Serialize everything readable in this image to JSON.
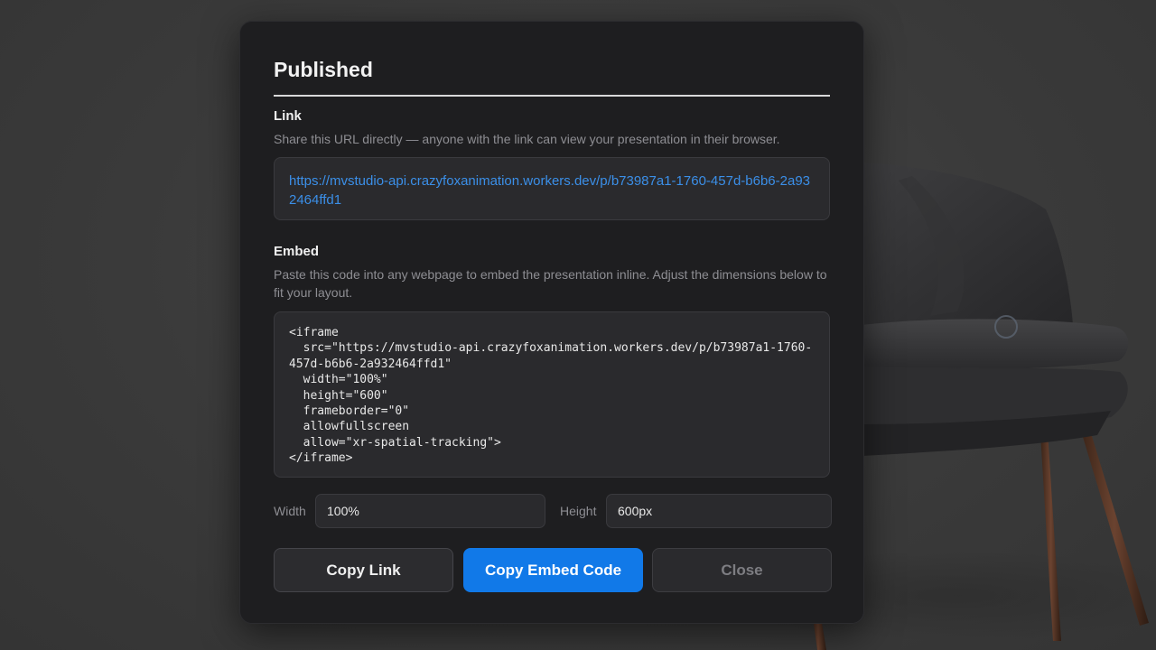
{
  "colors": {
    "accent": "#1179e8",
    "link": "#3b8fe8",
    "modal_bg": "#1e1e20"
  },
  "dialog": {
    "title": "Published",
    "link_section": {
      "label": "Link",
      "description": "Share this URL directly — anyone with the link can view your presentation in their browser.",
      "url": "https://mvstudio-api.crazyfoxanimation.workers.dev/p/b73987a1-1760-457d-b6b6-2a932464ffd1"
    },
    "embed_section": {
      "label": "Embed",
      "description": "Paste this code into any webpage to embed the presentation inline. Adjust the dimensions below to fit your layout.",
      "code": "<iframe\n  src=\"https://mvstudio-api.crazyfoxanimation.workers.dev/p/b73987a1-1760-457d-b6b6-2a932464ffd1\"\n  width=\"100%\"\n  height=\"600\"\n  frameborder=\"0\"\n  allowfullscreen\n  allow=\"xr-spatial-tracking\">\n</iframe>"
    },
    "dimensions": {
      "width_label": "Width",
      "width_value": "100%",
      "height_label": "Height",
      "height_value": "600px"
    },
    "buttons": {
      "copy_link": "Copy Link",
      "copy_embed": "Copy Embed Code",
      "close": "Close"
    }
  }
}
